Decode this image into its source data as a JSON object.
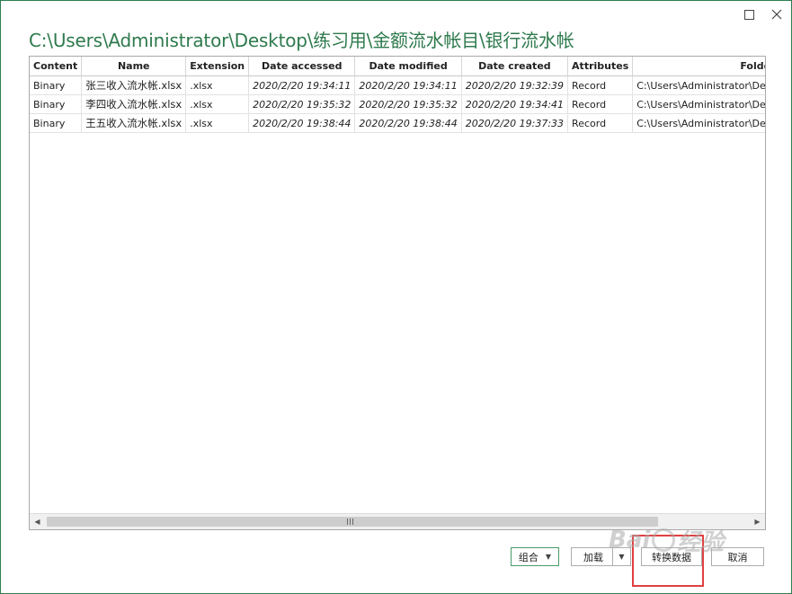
{
  "window": {
    "title": "C:\\Users\\Administrator\\Desktop\\练习用\\金额流水帐目\\银行流水帐",
    "maximize_icon": "maximize-icon",
    "close_icon": "close-icon"
  },
  "table": {
    "columns": [
      "Content",
      "Name",
      "Extension",
      "Date accessed",
      "Date modified",
      "Date created",
      "Attributes",
      "Folder Path"
    ],
    "rows": [
      [
        "Binary",
        "张三收入流水帐.xlsx",
        ".xlsx",
        "2020/2/20 19:34:11",
        "2020/2/20 19:34:11",
        "2020/2/20 19:32:39",
        "Record",
        "C:\\Users\\Administrator\\Desktop\\练"
      ],
      [
        "Binary",
        "李四收入流水帐.xlsx",
        ".xlsx",
        "2020/2/20 19:35:32",
        "2020/2/20 19:35:32",
        "2020/2/20 19:34:41",
        "Record",
        "C:\\Users\\Administrator\\Desktop\\练"
      ],
      [
        "Binary",
        "王五收入流水帐.xlsx",
        ".xlsx",
        "2020/2/20 19:38:44",
        "2020/2/20 19:38:44",
        "2020/2/20 19:37:33",
        "Record",
        "C:\\Users\\Administrator\\Desktop\\练"
      ]
    ]
  },
  "footer": {
    "combine_label": "组合",
    "load_label": "加载",
    "transform_label": "转换数据",
    "cancel_label": "取消"
  },
  "watermark": {
    "text_left": "Bai",
    "text_right": "经验"
  },
  "colors": {
    "accent": "#2e7a4d",
    "highlight": "#e04040"
  }
}
